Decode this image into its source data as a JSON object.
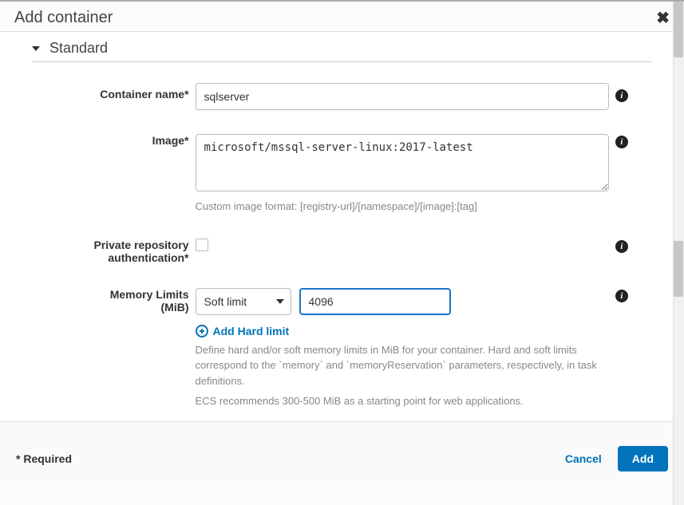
{
  "header": {
    "title": "Add container"
  },
  "section": {
    "standard": "Standard"
  },
  "form": {
    "container_name": {
      "label": "Container name*",
      "value": "sqlserver"
    },
    "image": {
      "label": "Image*",
      "value": "microsoft/mssql-server-linux:2017-latest",
      "help": "Custom image format: [registry-url]/[namespace]/[image]:[tag]"
    },
    "private_repo": {
      "label_line1": "Private repository",
      "label_line2": "authentication*"
    },
    "memory": {
      "label_line1": "Memory Limits",
      "label_line2": "(MiB)",
      "limit_type": "Soft limit",
      "value": "4096",
      "add_hard_label": "Add Hard limit",
      "help1": "Define hard and/or soft memory limits in MiB for your container. Hard and soft limits correspond to the `memory` and `memoryReservation` parameters, respectively, in task definitions.",
      "help2": "ECS recommends 300-500 MiB as a starting point for web applications."
    }
  },
  "footer": {
    "required_note": "* Required",
    "cancel": "Cancel",
    "add": "Add"
  }
}
